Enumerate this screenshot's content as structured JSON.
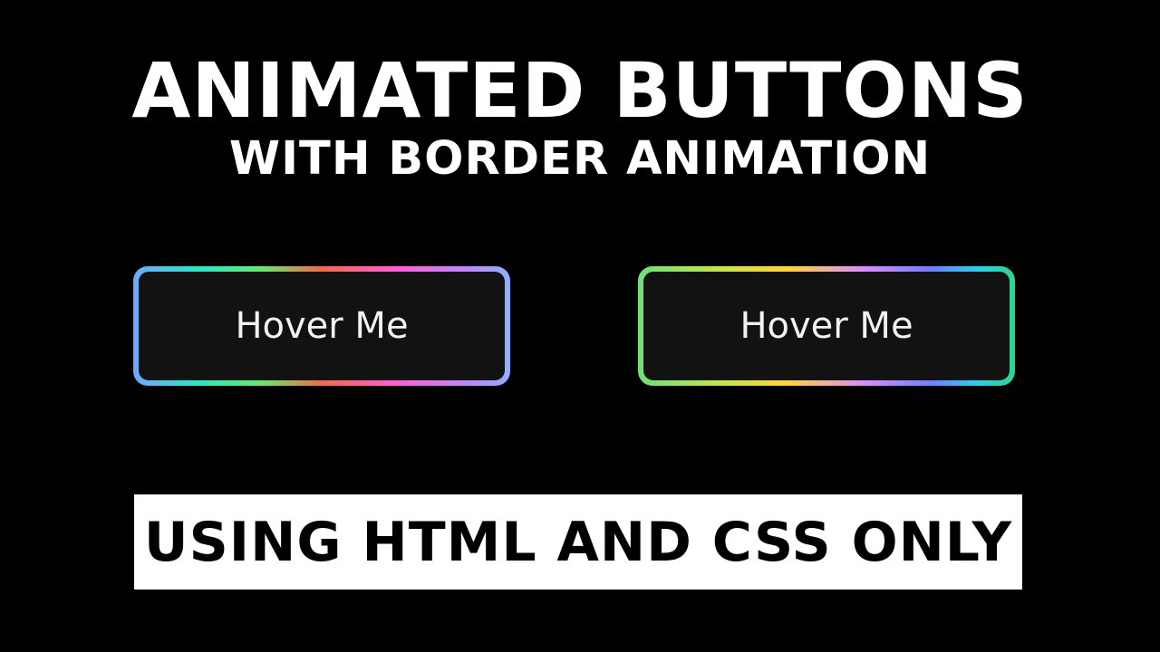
{
  "heading": {
    "title": "ANIMATED BUTTONS",
    "subtitle": "WITH BORDER ANIMATION"
  },
  "buttons": [
    {
      "label": "Hover Me"
    },
    {
      "label": "Hover Me"
    }
  ],
  "banner": {
    "text": "USING HTML AND CSS ONLY"
  },
  "colors": {
    "background": "#000000",
    "text": "#ffffff",
    "button_fill": "#121212",
    "banner_fill": "#ffffff"
  }
}
